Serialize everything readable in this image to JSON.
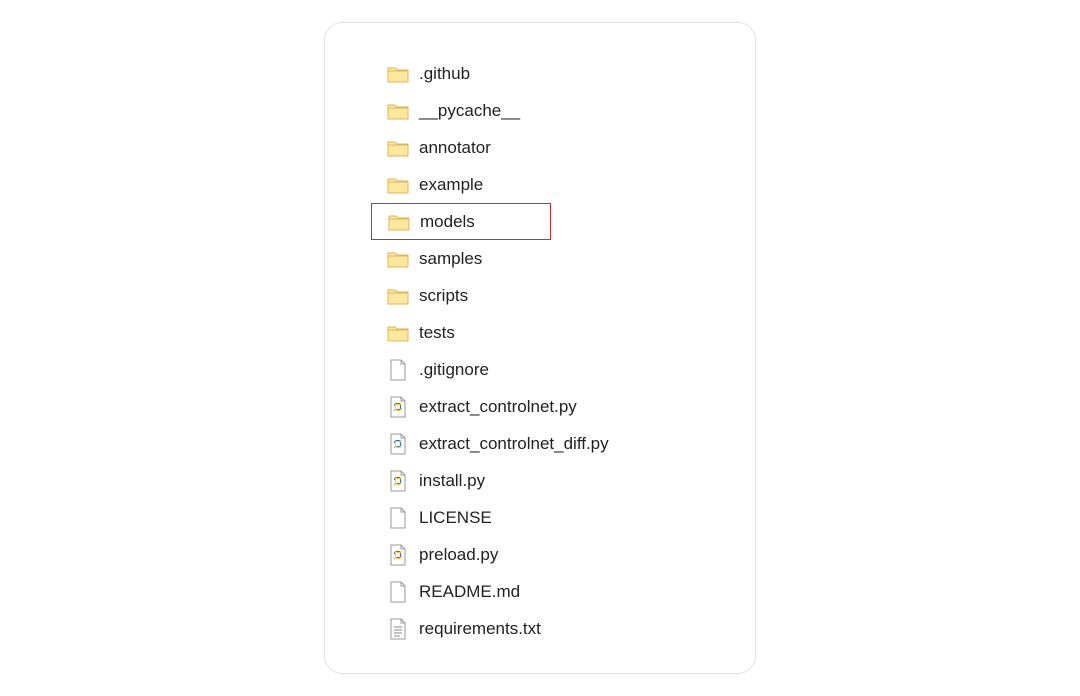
{
  "files": [
    {
      "name": ".github",
      "icon": "folder",
      "highlighted": false
    },
    {
      "name": "__pycache__",
      "icon": "folder",
      "highlighted": false
    },
    {
      "name": "annotator",
      "icon": "folder",
      "highlighted": false
    },
    {
      "name": "example",
      "icon": "folder",
      "highlighted": false
    },
    {
      "name": "models",
      "icon": "folder",
      "highlighted": true
    },
    {
      "name": "samples",
      "icon": "folder",
      "highlighted": false
    },
    {
      "name": "scripts",
      "icon": "folder",
      "highlighted": false
    },
    {
      "name": "tests",
      "icon": "folder",
      "highlighted": false
    },
    {
      "name": ".gitignore",
      "icon": "blank",
      "highlighted": false
    },
    {
      "name": "extract_controlnet.py",
      "icon": "python",
      "highlighted": false
    },
    {
      "name": "extract_controlnet_diff.py",
      "icon": "python",
      "highlighted": false
    },
    {
      "name": "install.py",
      "icon": "python",
      "highlighted": false
    },
    {
      "name": "LICENSE",
      "icon": "blank",
      "highlighted": false
    },
    {
      "name": "preload.py",
      "icon": "python",
      "highlighted": false
    },
    {
      "name": "README.md",
      "icon": "blank",
      "highlighted": false
    },
    {
      "name": "requirements.txt",
      "icon": "text",
      "highlighted": false
    }
  ]
}
